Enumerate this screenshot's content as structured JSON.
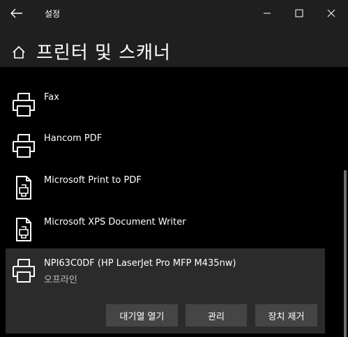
{
  "window": {
    "title": "설정",
    "back_icon": "back-arrow-icon",
    "minimize_icon": "minimize-icon",
    "maximize_icon": "maximize-icon",
    "close_icon": "close-icon"
  },
  "header": {
    "title": "프린터 및 스캐너",
    "icon": "home-icon"
  },
  "printers": [
    {
      "name": "Fax",
      "icon": "printer-icon"
    },
    {
      "name": "Hancom PDF",
      "icon": "printer-icon"
    },
    {
      "name": "Microsoft Print to PDF",
      "icon": "document-printer-icon"
    },
    {
      "name": "Microsoft XPS Document Writer",
      "icon": "document-printer-icon"
    },
    {
      "name": "NPI63C0DF (HP LaserJet Pro MFP M435nw)",
      "status": "오프라인",
      "icon": "printer-icon",
      "selected": true
    }
  ],
  "actions": {
    "open_queue": "대기열 열기",
    "manage": "관리",
    "remove_device": "장치 제거"
  },
  "colors": {
    "titlebar_bg": "#1f1f1f",
    "content_bg": "#000000",
    "selected_bg": "#2b2b2b",
    "button_bg": "#454545"
  }
}
